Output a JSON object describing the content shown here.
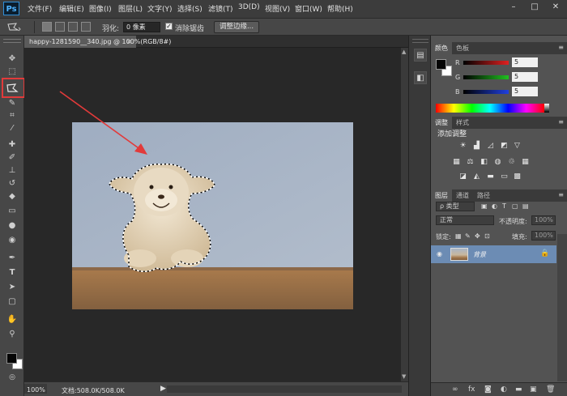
{
  "app": {
    "logo": "Ps"
  },
  "menu": {
    "items": [
      "文件(F)",
      "编辑(E)",
      "图像(I)",
      "图层(L)",
      "文字(Y)",
      "选择(S)",
      "滤镜(T)",
      "3D(D)",
      "视图(V)",
      "窗口(W)",
      "帮助(H)"
    ]
  },
  "window_controls": {
    "minimize": "–",
    "maximize": "□",
    "close": "✕"
  },
  "options": {
    "feather_label": "羽化:",
    "feather_value": "0 像素",
    "antialias_label": "消除锯齿",
    "antialias_checked": "✓",
    "refine_edge": "调整边缘..."
  },
  "document": {
    "tab_title": "happy-1281590__340.jpg @ 100%(RGB/8#)",
    "tab_close": "×",
    "zoom": "100%",
    "info": "文档:508.0K/508.0K"
  },
  "color_panel": {
    "tabs": [
      "颜色",
      "色板"
    ],
    "channels": [
      {
        "label": "R",
        "value": "5",
        "color": "#e02020"
      },
      {
        "label": "G",
        "value": "5",
        "color": "#20c020"
      },
      {
        "label": "B",
        "value": "5",
        "color": "#2040e0"
      }
    ],
    "foreground": "#050505",
    "background": "#ffffff"
  },
  "adjust_panel": {
    "tabs": [
      "调整",
      "样式"
    ],
    "title": "添加调整"
  },
  "layers_panel": {
    "tabs": [
      "图层",
      "通道",
      "路径"
    ],
    "kind": "ρ 类型",
    "blend_mode": "正常",
    "opacity_label": "不透明度:",
    "opacity_value": "100%",
    "lock_label": "锁定:",
    "fill_label": "填充:",
    "fill_value": "100%",
    "layers": [
      {
        "name": "背景"
      }
    ]
  },
  "icons": [
    "move-icon",
    "marquee-icon",
    "polygonal-lasso-icon",
    "quick-select-icon",
    "crop-icon",
    "eyedropper-icon",
    "healing-brush-icon",
    "brush-icon",
    "clone-stamp-icon",
    "history-brush-icon",
    "eraser-icon",
    "gradient-icon",
    "blur-icon",
    "dodge-icon",
    "pen-icon",
    "type-icon",
    "path-select-icon",
    "shape-icon",
    "hand-icon",
    "zoom-icon"
  ]
}
